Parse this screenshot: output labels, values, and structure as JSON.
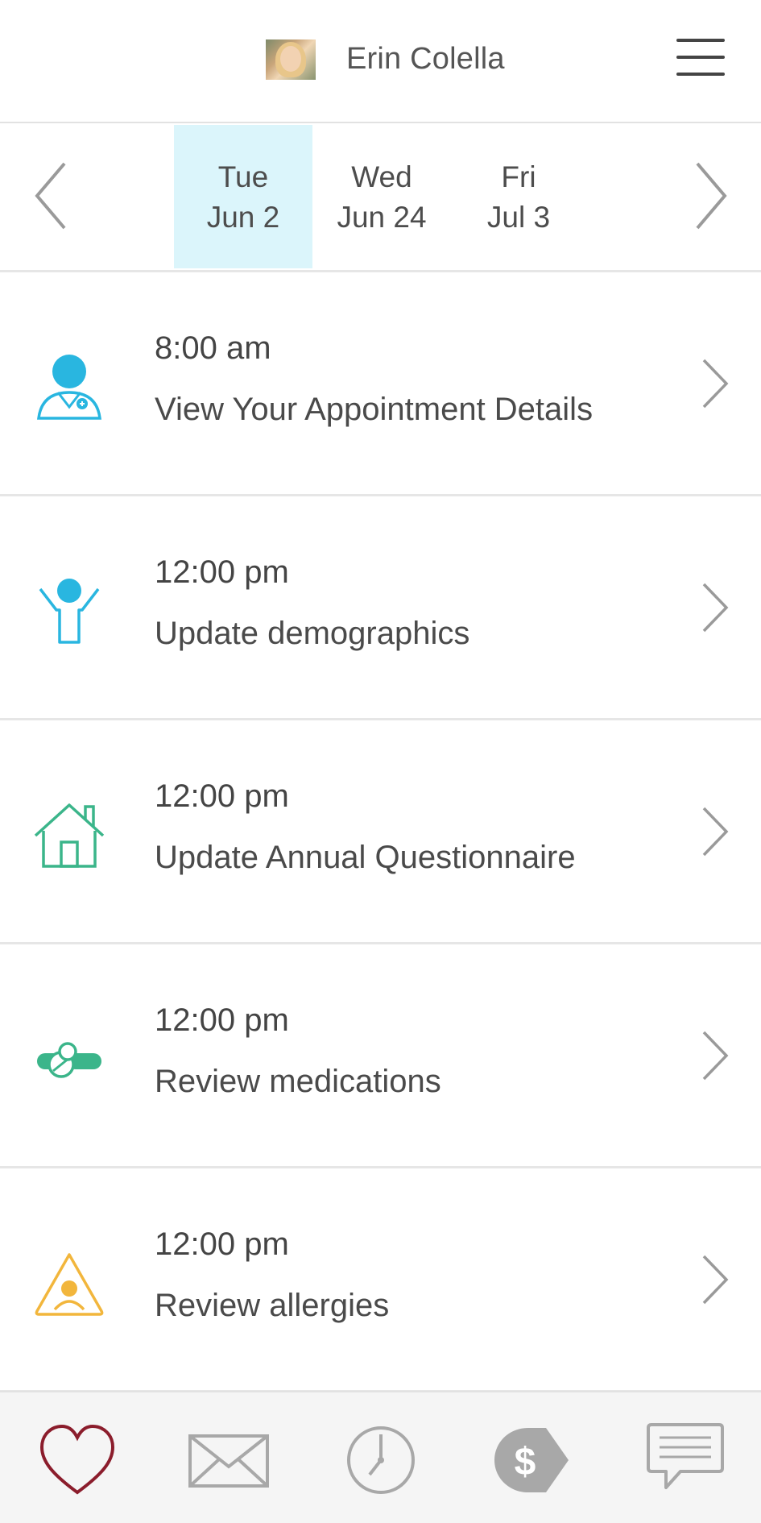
{
  "header": {
    "user_name": "Erin Colella",
    "avatar_icon": "user-photo",
    "menu_icon": "hamburger-menu-icon"
  },
  "dates": [
    {
      "weekday": "Tue",
      "date": "Jun 2",
      "selected": true
    },
    {
      "weekday": "Wed",
      "date": "Jun 24",
      "selected": false
    },
    {
      "weekday": "Fri",
      "date": "Jul 3",
      "selected": false
    }
  ],
  "tasks": [
    {
      "time": "8:00 am",
      "title": "View Your Appointment Details",
      "icon": "doctor-icon",
      "color": "#29b6e0"
    },
    {
      "time": "12:00 pm",
      "title": "Update demographics",
      "icon": "person-arms-up-icon",
      "color": "#29b6e0"
    },
    {
      "time": "12:00 pm",
      "title": "Update Annual Questionnaire",
      "icon": "house-icon",
      "color": "#3bb58a"
    },
    {
      "time": "12:00 pm",
      "title": "Review medications",
      "icon": "pills-icon",
      "color": "#3bb58a"
    },
    {
      "time": "12:00 pm",
      "title": "Review allergies",
      "icon": "allergy-warning-icon",
      "color": "#f2b63c"
    }
  ],
  "bottom_nav": [
    {
      "icon": "heart-icon",
      "active": true,
      "color": "#8b1d2c"
    },
    {
      "icon": "mail-icon",
      "active": false,
      "color": "#a8a8a8"
    },
    {
      "icon": "clock-icon",
      "active": false,
      "color": "#a8a8a8"
    },
    {
      "icon": "billing-dollar-tag-icon",
      "active": false,
      "color": "#a8a8a8"
    },
    {
      "icon": "chat-icon",
      "active": false,
      "color": "#a8a8a8"
    }
  ],
  "colors": {
    "selected_date_bg": "#dbf5fb",
    "divider": "#e6e6e6",
    "text": "#4a4a4a"
  }
}
